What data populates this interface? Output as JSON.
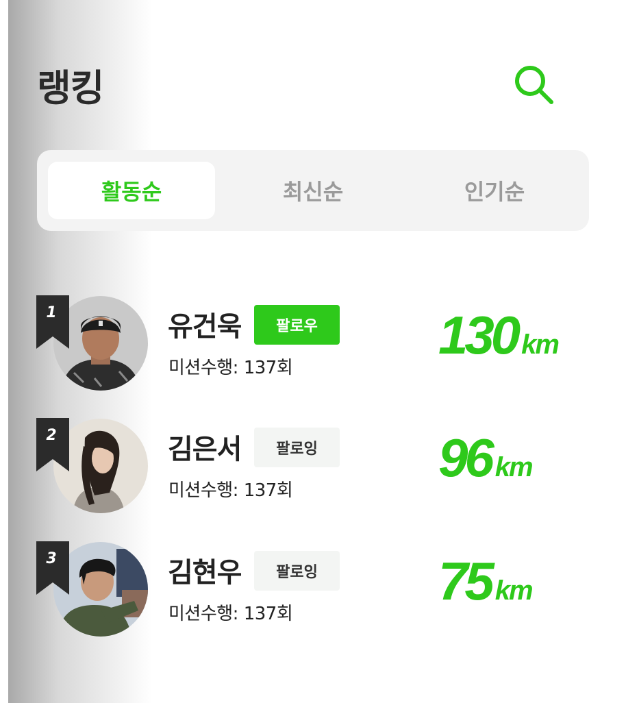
{
  "header": {
    "title": "랭킹",
    "search_icon": "search-icon",
    "accent_color": "#2ec91b"
  },
  "tabs": [
    {
      "label": "활동순",
      "active": true
    },
    {
      "label": "최신순",
      "active": false
    },
    {
      "label": "인기순",
      "active": false
    }
  ],
  "rankings": [
    {
      "rank": "1",
      "name": "유건욱",
      "follow_label": "팔로우",
      "mission": "미션수행: 137회",
      "distance": "130",
      "unit": "km"
    },
    {
      "rank": "2",
      "name": "김은서",
      "follow_label": "팔로잉",
      "mission": "미션수행: 137회",
      "distance": "96",
      "unit": "km"
    },
    {
      "rank": "3",
      "name": "김현우",
      "follow_label": "팔로잉",
      "mission": "미션수행: 137회",
      "distance": "75",
      "unit": "km"
    }
  ]
}
